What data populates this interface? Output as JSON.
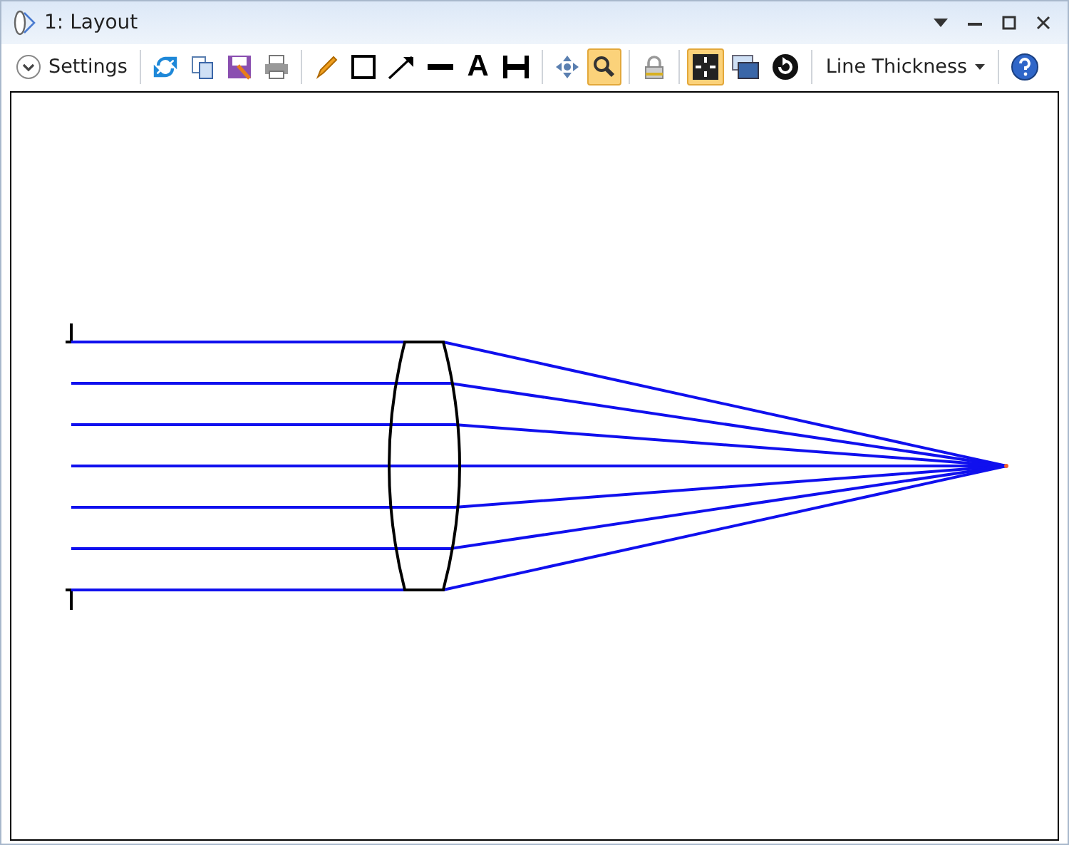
{
  "window": {
    "title": "1: Layout"
  },
  "toolbar": [
    {
      "kind": "settings",
      "label": "Settings",
      "selected": false
    },
    {
      "kind": "sep"
    },
    {
      "kind": "refresh",
      "selected": false
    },
    {
      "kind": "copy",
      "selected": false
    },
    {
      "kind": "save",
      "selected": false
    },
    {
      "kind": "print",
      "selected": false
    },
    {
      "kind": "sep"
    },
    {
      "kind": "pencil",
      "selected": false
    },
    {
      "kind": "rect",
      "selected": false
    },
    {
      "kind": "arrow",
      "selected": false
    },
    {
      "kind": "line",
      "selected": false
    },
    {
      "kind": "text",
      "label": "A",
      "selected": false
    },
    {
      "kind": "dimension",
      "selected": false
    },
    {
      "kind": "sep"
    },
    {
      "kind": "pan",
      "selected": false
    },
    {
      "kind": "zoom",
      "selected": true
    },
    {
      "kind": "sep"
    },
    {
      "kind": "lock",
      "selected": false
    },
    {
      "kind": "sep"
    },
    {
      "kind": "fit",
      "selected": true
    },
    {
      "kind": "window",
      "selected": false
    },
    {
      "kind": "rotate",
      "selected": false
    },
    {
      "kind": "sep"
    },
    {
      "kind": "dropdown",
      "label": "Line Thickness",
      "selected": false
    },
    {
      "kind": "sep"
    },
    {
      "kind": "help",
      "selected": false
    }
  ]
}
